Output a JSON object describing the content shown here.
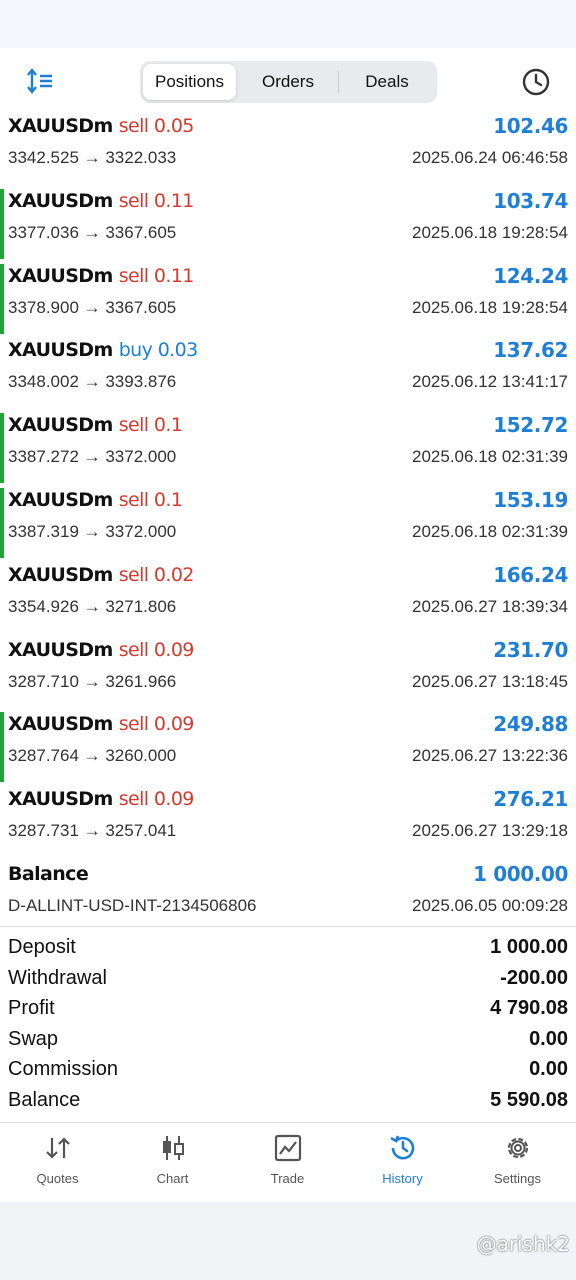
{
  "header": {
    "tabs": [
      {
        "label": "Positions",
        "active": true
      },
      {
        "label": "Orders",
        "active": false
      },
      {
        "label": "Deals",
        "active": false
      }
    ],
    "left_icon": "sort-icon",
    "right_icon": "clock-icon"
  },
  "deals": [
    {
      "symbol": "XAUUSDm",
      "side": "sell",
      "volume": "sell 0.05",
      "profit": "102.46",
      "prices": "3342.525 → 3322.033",
      "time": "2025.06.24 06:46:58",
      "flag": false
    },
    {
      "symbol": "XAUUSDm",
      "side": "sell",
      "volume": "sell 0.11",
      "profit": "103.74",
      "prices": "3377.036 → 3367.605",
      "time": "2025.06.18 19:28:54",
      "flag": true
    },
    {
      "symbol": "XAUUSDm",
      "side": "sell",
      "volume": "sell 0.11",
      "profit": "124.24",
      "prices": "3378.900 → 3367.605",
      "time": "2025.06.18 19:28:54",
      "flag": true
    },
    {
      "symbol": "XAUUSDm",
      "side": "buy",
      "volume": "buy 0.03",
      "profit": "137.62",
      "prices": "3348.002 → 3393.876",
      "time": "2025.06.12 13:41:17",
      "flag": false
    },
    {
      "symbol": "XAUUSDm",
      "side": "sell",
      "volume": "sell 0.1",
      "profit": "152.72",
      "prices": "3387.272 → 3372.000",
      "time": "2025.06.18 02:31:39",
      "flag": true
    },
    {
      "symbol": "XAUUSDm",
      "side": "sell",
      "volume": "sell 0.1",
      "profit": "153.19",
      "prices": "3387.319 → 3372.000",
      "time": "2025.06.18 02:31:39",
      "flag": true
    },
    {
      "symbol": "XAUUSDm",
      "side": "sell",
      "volume": "sell 0.02",
      "profit": "166.24",
      "prices": "3354.926 → 3271.806",
      "time": "2025.06.27 18:39:34",
      "flag": false
    },
    {
      "symbol": "XAUUSDm",
      "side": "sell",
      "volume": "sell 0.09",
      "profit": "231.70",
      "prices": "3287.710 → 3261.966",
      "time": "2025.06.27 13:18:45",
      "flag": false
    },
    {
      "symbol": "XAUUSDm",
      "side": "sell",
      "volume": "sell 0.09",
      "profit": "249.88",
      "prices": "3287.764 → 3260.000",
      "time": "2025.06.27 13:22:36",
      "flag": true
    },
    {
      "symbol": "XAUUSDm",
      "side": "sell",
      "volume": "sell 0.09",
      "profit": "276.21",
      "prices": "3287.731 → 3257.041",
      "time": "2025.06.27 13:29:18",
      "flag": false
    },
    {
      "symbol": "Balance",
      "side": "",
      "volume": "",
      "profit": "1 000.00",
      "prices": "D-ALLINT-USD-INT-2134506806",
      "time": "2025.06.05 00:09:28",
      "flag": false
    }
  ],
  "summary": [
    {
      "label": "Deposit",
      "value": "1 000.00"
    },
    {
      "label": "Withdrawal",
      "value": "-200.00"
    },
    {
      "label": "Profit",
      "value": "4 790.08"
    },
    {
      "label": "Swap",
      "value": "0.00"
    },
    {
      "label": "Commission",
      "value": "0.00"
    },
    {
      "label": "Balance",
      "value": "5 590.08"
    }
  ],
  "tabbar": [
    {
      "label": "Quotes",
      "icon": "quotes-icon",
      "active": false
    },
    {
      "label": "Chart",
      "icon": "chart-icon",
      "active": false
    },
    {
      "label": "Trade",
      "icon": "trade-icon",
      "active": false
    },
    {
      "label": "History",
      "icon": "history-icon",
      "active": true
    },
    {
      "label": "Settings",
      "icon": "settings-icon",
      "active": false
    }
  ],
  "watermark": "@arishk2",
  "colors": {
    "sell": "#d63a2f",
    "buy": "#1f7fd4",
    "profit": "#1f7fd4",
    "accent": "#1f7fd4",
    "flag_bar": "#21a336"
  }
}
